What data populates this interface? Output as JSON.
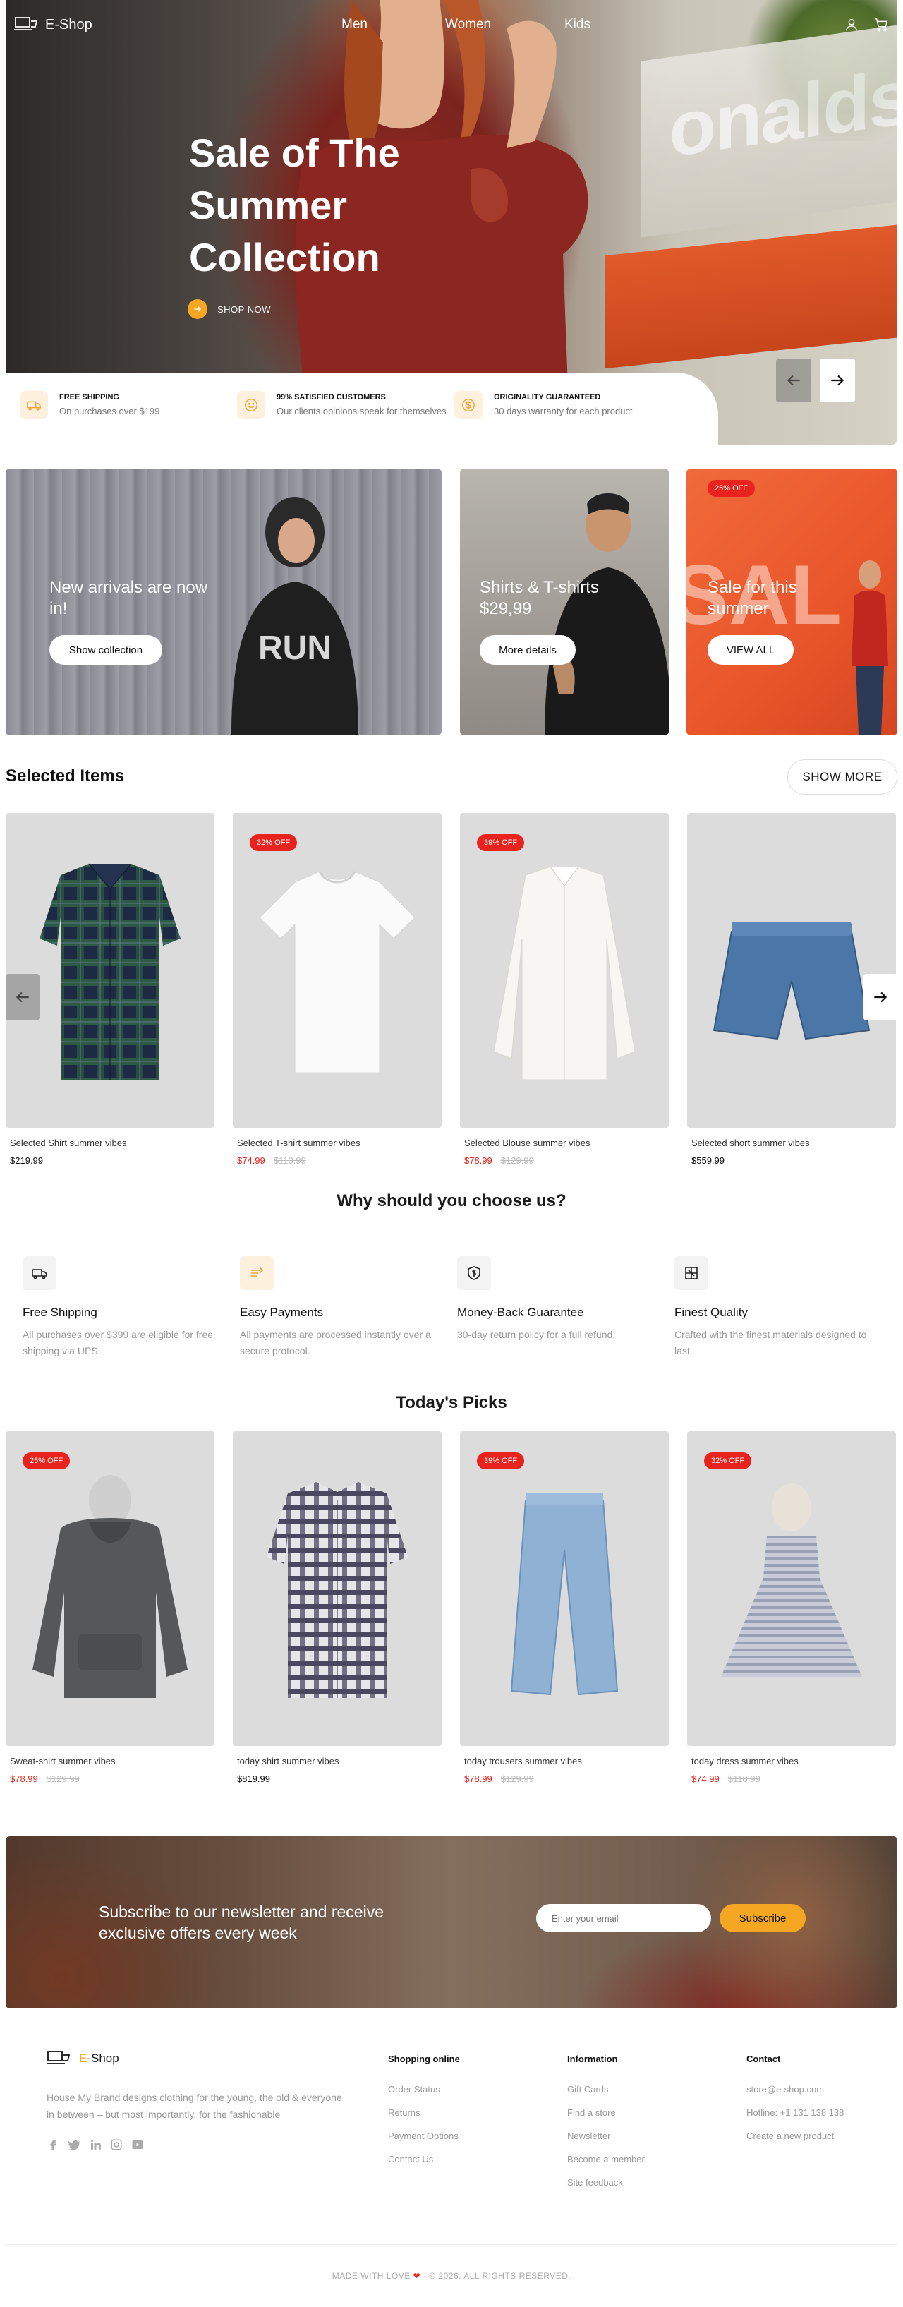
{
  "brand": {
    "name": "E-Shop",
    "footer_prefix": "E",
    "footer_suffix": "-Shop"
  },
  "nav": {
    "links": [
      "Men",
      "Women",
      "Kids"
    ]
  },
  "hero": {
    "title": "Sale of The Summer Collection",
    "cta": "SHOP NOW",
    "backdrop_text": "onalds"
  },
  "perks": [
    {
      "title": "FREE SHIPPING",
      "desc": "On purchases over $199",
      "icon": "truck-icon"
    },
    {
      "title": "99% SATISFIED CUSTOMERS",
      "desc": "Our clients opinions speak for themselves",
      "icon": "smile-icon"
    },
    {
      "title": "ORIGINALITY GUARANTEED",
      "desc": "30 days warranty for each product",
      "icon": "dollar-icon"
    }
  ],
  "promos": [
    {
      "text": "New arrivals are now in!",
      "button": "Show collection",
      "backdrop_text": "RUN"
    },
    {
      "text": "Shirts & T-shirts $29,99",
      "button": "More details"
    },
    {
      "text": "Sale for this summer",
      "button": "VIEW ALL",
      "badge": "25% OFF",
      "backdrop_text": "SAL"
    }
  ],
  "selected": {
    "title": "Selected Items",
    "show_more": "SHOW MORE",
    "items": [
      {
        "name": "Selected Shirt summer vibes",
        "price": "$219.99",
        "sale": "",
        "old": "",
        "badge": "",
        "kind": "plaid-shirt"
      },
      {
        "name": "Selected T-shirt summer vibes",
        "price": "",
        "sale": "$74.99",
        "old": "$110.99",
        "badge": "32% OFF",
        "kind": "tshirt"
      },
      {
        "name": "Selected Blouse summer vibes",
        "price": "",
        "sale": "$78.99",
        "old": "$129.99",
        "badge": "39% OFF",
        "kind": "blouse"
      },
      {
        "name": "Selected short summer vibes",
        "price": "$559.99",
        "sale": "",
        "old": "",
        "badge": "",
        "kind": "shorts"
      }
    ]
  },
  "why": {
    "title": "Why should you choose us?",
    "items": [
      {
        "title": "Free Shipping",
        "desc": "All purchases over $399 are eligible for free shipping via UPS.",
        "icon": "truck-icon"
      },
      {
        "title": "Easy Payments",
        "desc": "All payments are processed instantly over a secure protocol.",
        "icon": "payment-icon"
      },
      {
        "title": "Money-Back Guarantee",
        "desc": "30-day return policy for a full refund.",
        "icon": "shield-dollar-icon"
      },
      {
        "title": "Finest Quality",
        "desc": "Crafted with the finest materials designed to last.",
        "icon": "quality-icon"
      }
    ]
  },
  "picks": {
    "title": "Today's Picks",
    "items": [
      {
        "name": "Sweat-shirt summer vibes",
        "price": "",
        "sale": "$78.99",
        "old": "$129.99",
        "badge": "25% OFF",
        "kind": "hoodie"
      },
      {
        "name": "today shirt summer vibes",
        "price": "$819.99",
        "sale": "",
        "old": "",
        "badge": "",
        "kind": "check-shirt"
      },
      {
        "name": "today trousers summer vibes",
        "price": "",
        "sale": "$78.99",
        "old": "$129.99",
        "badge": "39% OFF",
        "kind": "jeans"
      },
      {
        "name": "today dress summer vibes",
        "price": "",
        "sale": "$74.99",
        "old": "$110.99",
        "badge": "32% OFF",
        "kind": "dress"
      }
    ]
  },
  "newsletter": {
    "text": "Subscribe to our newsletter and receive exclusive offers every week",
    "placeholder": "Enter your email",
    "button": "Subscribe"
  },
  "footer": {
    "about": "House My Brand designs clothing for the young, the old & everyone in between – but most importantly, for the fashionable",
    "columns": [
      {
        "title": "Shopping online",
        "links": [
          "Order Status",
          "Returns",
          "Payment Options",
          "Contact Us"
        ]
      },
      {
        "title": "Information",
        "links": [
          "Gift Cards",
          "Find a store",
          "Newsletter",
          "Become a member",
          "Site feedback"
        ]
      },
      {
        "title": "Contact",
        "links": [
          "store@e-shop.com",
          "Hotline: +1 131 138 138",
          "Create a new product"
        ]
      }
    ],
    "copyright_left": "MADE WITH LOVE",
    "copyright_right": " - © 2026. ALL RIGHTS RESERVED."
  },
  "colors": {
    "accent": "#f5a623",
    "sale": "#e8231d",
    "card_bg": "#dcdcdc"
  }
}
